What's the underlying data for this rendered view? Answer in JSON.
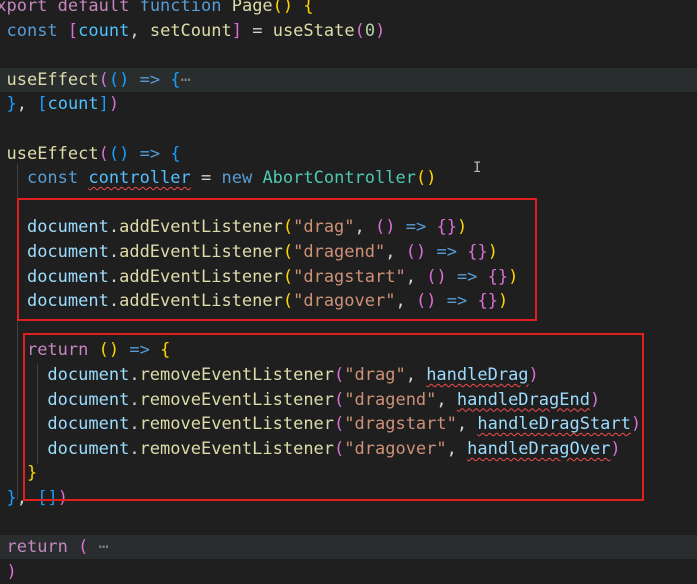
{
  "colors": {
    "background": "#1f1f1f",
    "keyword": "#569cd6",
    "control": "#c586c0",
    "function": "#dcdcaa",
    "variable": "#9cdcfe",
    "constant": "#4fc1ff",
    "class": "#4ec9b0",
    "string": "#ce9178",
    "number": "#b5cea8",
    "text": "#d4d4d4",
    "fold": "#808080",
    "bracketGold": "#ffd700",
    "bracketPurple": "#da70d6",
    "bracketBlue": "#179fff",
    "highlightBox": "#e0201f"
  },
  "lines": [
    {
      "tokens": [
        {
          "t": "export",
          "c": "control"
        },
        {
          "t": " "
        },
        {
          "t": "default",
          "c": "control"
        },
        {
          "t": " "
        },
        {
          "t": "function",
          "c": "keyword"
        },
        {
          "t": " "
        },
        {
          "t": "Page",
          "c": "function"
        },
        {
          "t": "(",
          "c": "bracketGold"
        },
        {
          "t": ")",
          "c": "bracketGold"
        },
        {
          "t": " "
        },
        {
          "t": "{",
          "c": "bracketGold"
        }
      ]
    },
    {
      "tokens": [
        {
          "t": "  "
        },
        {
          "t": "const",
          "c": "keyword"
        },
        {
          "t": " "
        },
        {
          "t": "[",
          "c": "bracketPurple"
        },
        {
          "t": "count",
          "c": "constant"
        },
        {
          "t": ", "
        },
        {
          "t": "setCount",
          "c": "function"
        },
        {
          "t": "]",
          "c": "bracketPurple"
        },
        {
          "t": " = "
        },
        {
          "t": "useState",
          "c": "function"
        },
        {
          "t": "(",
          "c": "bracketPurple"
        },
        {
          "t": "0",
          "c": "number"
        },
        {
          "t": ")",
          "c": "bracketPurple"
        }
      ]
    },
    {
      "tokens": []
    },
    {
      "hl": true,
      "tokens": [
        {
          "t": "  "
        },
        {
          "t": "useEffect",
          "c": "function"
        },
        {
          "t": "(",
          "c": "bracketPurple"
        },
        {
          "t": "(",
          "c": "bracketBlue"
        },
        {
          "t": ")",
          "c": "bracketBlue"
        },
        {
          "t": " "
        },
        {
          "t": "=>",
          "c": "keyword"
        },
        {
          "t": " "
        },
        {
          "t": "{",
          "c": "bracketBlue"
        },
        {
          "t": "⋯",
          "c": "fold"
        }
      ]
    },
    {
      "tokens": [
        {
          "t": "  "
        },
        {
          "t": "}",
          "c": "bracketBlue"
        },
        {
          "t": ", "
        },
        {
          "t": "[",
          "c": "bracketBlue"
        },
        {
          "t": "count",
          "c": "constant"
        },
        {
          "t": "]",
          "c": "bracketBlue"
        },
        {
          "t": ")",
          "c": "bracketPurple"
        }
      ]
    },
    {
      "tokens": []
    },
    {
      "tokens": [
        {
          "t": "  "
        },
        {
          "t": "useEffect",
          "c": "function"
        },
        {
          "t": "(",
          "c": "bracketPurple"
        },
        {
          "t": "(",
          "c": "bracketBlue"
        },
        {
          "t": ")",
          "c": "bracketBlue"
        },
        {
          "t": " "
        },
        {
          "t": "=>",
          "c": "keyword"
        },
        {
          "t": " "
        },
        {
          "t": "{",
          "c": "bracketBlue"
        }
      ]
    },
    {
      "tokens": [
        {
          "t": "    "
        },
        {
          "t": "const",
          "c": "keyword"
        },
        {
          "t": " "
        },
        {
          "t": "controller",
          "c": "constant",
          "sq": true
        },
        {
          "t": " = "
        },
        {
          "t": "new",
          "c": "keyword"
        },
        {
          "t": " "
        },
        {
          "t": "AbortController",
          "c": "class"
        },
        {
          "t": "(",
          "c": "bracketGold"
        },
        {
          "t": ")",
          "c": "bracketGold"
        }
      ]
    },
    {
      "tokens": []
    },
    {
      "tokens": [
        {
          "t": "    "
        },
        {
          "t": "document",
          "c": "variable"
        },
        {
          "t": "."
        },
        {
          "t": "addEventListener",
          "c": "function"
        },
        {
          "t": "(",
          "c": "bracketGold"
        },
        {
          "t": "\"drag\"",
          "c": "string"
        },
        {
          "t": ", "
        },
        {
          "t": "(",
          "c": "bracketPurple"
        },
        {
          "t": ")",
          "c": "bracketPurple"
        },
        {
          "t": " "
        },
        {
          "t": "=>",
          "c": "keyword"
        },
        {
          "t": " "
        },
        {
          "t": "{",
          "c": "bracketPurple"
        },
        {
          "t": "}",
          "c": "bracketPurple"
        },
        {
          "t": ")",
          "c": "bracketGold"
        }
      ]
    },
    {
      "tokens": [
        {
          "t": "    "
        },
        {
          "t": "document",
          "c": "variable"
        },
        {
          "t": "."
        },
        {
          "t": "addEventListener",
          "c": "function"
        },
        {
          "t": "(",
          "c": "bracketGold"
        },
        {
          "t": "\"dragend\"",
          "c": "string"
        },
        {
          "t": ", "
        },
        {
          "t": "(",
          "c": "bracketPurple"
        },
        {
          "t": ")",
          "c": "bracketPurple"
        },
        {
          "t": " "
        },
        {
          "t": "=>",
          "c": "keyword"
        },
        {
          "t": " "
        },
        {
          "t": "{",
          "c": "bracketPurple"
        },
        {
          "t": "}",
          "c": "bracketPurple"
        },
        {
          "t": ")",
          "c": "bracketGold"
        }
      ]
    },
    {
      "tokens": [
        {
          "t": "    "
        },
        {
          "t": "document",
          "c": "variable"
        },
        {
          "t": "."
        },
        {
          "t": "addEventListener",
          "c": "function"
        },
        {
          "t": "(",
          "c": "bracketGold"
        },
        {
          "t": "\"dragstart\"",
          "c": "string"
        },
        {
          "t": ", "
        },
        {
          "t": "(",
          "c": "bracketPurple"
        },
        {
          "t": ")",
          "c": "bracketPurple"
        },
        {
          "t": " "
        },
        {
          "t": "=>",
          "c": "keyword"
        },
        {
          "t": " "
        },
        {
          "t": "{",
          "c": "bracketPurple"
        },
        {
          "t": "}",
          "c": "bracketPurple"
        },
        {
          "t": ")",
          "c": "bracketGold"
        }
      ]
    },
    {
      "tokens": [
        {
          "t": "    "
        },
        {
          "t": "document",
          "c": "variable"
        },
        {
          "t": "."
        },
        {
          "t": "addEventListener",
          "c": "function"
        },
        {
          "t": "(",
          "c": "bracketGold"
        },
        {
          "t": "\"dragover\"",
          "c": "string"
        },
        {
          "t": ", "
        },
        {
          "t": "(",
          "c": "bracketPurple"
        },
        {
          "t": ")",
          "c": "bracketPurple"
        },
        {
          "t": " "
        },
        {
          "t": "=>",
          "c": "keyword"
        },
        {
          "t": " "
        },
        {
          "t": "{",
          "c": "bracketPurple"
        },
        {
          "t": "}",
          "c": "bracketPurple"
        },
        {
          "t": ")",
          "c": "bracketGold"
        }
      ]
    },
    {
      "tokens": []
    },
    {
      "tokens": [
        {
          "t": "    "
        },
        {
          "t": "return",
          "c": "control"
        },
        {
          "t": " "
        },
        {
          "t": "(",
          "c": "bracketGold"
        },
        {
          "t": ")",
          "c": "bracketGold"
        },
        {
          "t": " "
        },
        {
          "t": "=>",
          "c": "keyword"
        },
        {
          "t": " "
        },
        {
          "t": "{",
          "c": "bracketGold"
        }
      ]
    },
    {
      "tokens": [
        {
          "t": "      "
        },
        {
          "t": "document",
          "c": "variable"
        },
        {
          "t": "."
        },
        {
          "t": "removeEventListener",
          "c": "function"
        },
        {
          "t": "(",
          "c": "bracketPurple"
        },
        {
          "t": "\"drag\"",
          "c": "string"
        },
        {
          "t": ", "
        },
        {
          "t": "handleDrag",
          "c": "variable",
          "sq": true
        },
        {
          "t": ")",
          "c": "bracketPurple"
        }
      ]
    },
    {
      "tokens": [
        {
          "t": "      "
        },
        {
          "t": "document",
          "c": "variable"
        },
        {
          "t": "."
        },
        {
          "t": "removeEventListener",
          "c": "function"
        },
        {
          "t": "(",
          "c": "bracketPurple"
        },
        {
          "t": "\"dragend\"",
          "c": "string"
        },
        {
          "t": ", "
        },
        {
          "t": "handleDragEnd",
          "c": "variable",
          "sq": true
        },
        {
          "t": ")",
          "c": "bracketPurple"
        }
      ]
    },
    {
      "tokens": [
        {
          "t": "      "
        },
        {
          "t": "document",
          "c": "variable"
        },
        {
          "t": "."
        },
        {
          "t": "removeEventListener",
          "c": "function"
        },
        {
          "t": "(",
          "c": "bracketPurple"
        },
        {
          "t": "\"dragstart\"",
          "c": "string"
        },
        {
          "t": ", "
        },
        {
          "t": "handleDragStart",
          "c": "variable",
          "sq": true
        },
        {
          "t": ")",
          "c": "bracketPurple"
        }
      ]
    },
    {
      "tokens": [
        {
          "t": "      "
        },
        {
          "t": "document",
          "c": "variable"
        },
        {
          "t": "."
        },
        {
          "t": "removeEventListener",
          "c": "function"
        },
        {
          "t": "(",
          "c": "bracketPurple"
        },
        {
          "t": "\"dragover\"",
          "c": "string"
        },
        {
          "t": ", "
        },
        {
          "t": "handleDragOver",
          "c": "variable",
          "sq": true
        },
        {
          "t": ")",
          "c": "bracketPurple"
        }
      ]
    },
    {
      "tokens": [
        {
          "t": "    "
        },
        {
          "t": "}",
          "c": "bracketGold"
        }
      ]
    },
    {
      "tokens": [
        {
          "t": "  "
        },
        {
          "t": "}",
          "c": "bracketBlue"
        },
        {
          "t": ", "
        },
        {
          "t": "[",
          "c": "bracketBlue"
        },
        {
          "t": "]",
          "c": "bracketBlue"
        },
        {
          "t": ")",
          "c": "bracketPurple"
        }
      ]
    },
    {
      "tokens": []
    },
    {
      "hl": true,
      "tokens": [
        {
          "t": "  "
        },
        {
          "t": "return",
          "c": "control"
        },
        {
          "t": " "
        },
        {
          "t": "(",
          "c": "bracketPurple"
        },
        {
          "t": " "
        },
        {
          "t": "⋯",
          "c": "fold"
        }
      ]
    },
    {
      "tokens": [
        {
          "t": "  "
        },
        {
          "t": ")",
          "c": "bracketPurple"
        }
      ]
    }
  ]
}
